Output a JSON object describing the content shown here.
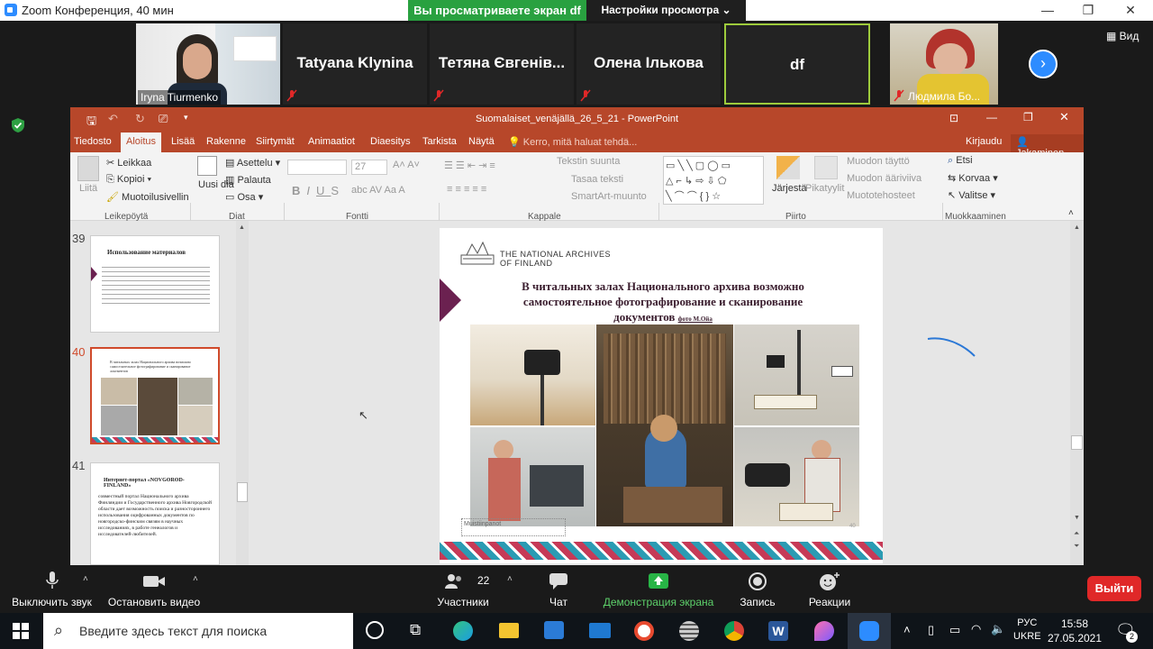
{
  "zoom": {
    "window_title": "Zoom Конференция, 40 мин",
    "share_banner": "Вы просматриваете экран df",
    "view_options": "Настройки просмотра ⌄",
    "view_label": "Вид",
    "participants": [
      {
        "name": "Iryna Tiurmenko",
        "has_video": true
      },
      {
        "name": "Tatyana Klynina",
        "has_video": false
      },
      {
        "name": "Тетяна Євгенів...",
        "has_video": false
      },
      {
        "name": "Олена Ількова",
        "has_video": false
      },
      {
        "name": "df",
        "has_video": false,
        "active": true
      },
      {
        "name": "Людмила Бо...",
        "has_video": true
      }
    ],
    "toolbar": {
      "mute": "Выключить звук",
      "stop_video": "Остановить видео",
      "participants_label": "Участники",
      "participants_count": "22",
      "chat": "Чат",
      "share": "Демонстрация экрана",
      "record": "Запись",
      "reactions": "Реакции",
      "leave": "Выйти"
    }
  },
  "ppt": {
    "title": "Suomalaiset_venäjällä_26_5_21 - PowerPoint",
    "tabs": [
      "Tiedosto",
      "Aloitus",
      "Lisää",
      "Rakenne",
      "Siirtymät",
      "Animaatiot",
      "Diaesitys",
      "Tarkista",
      "Näytä"
    ],
    "tell_me": "Kerro, mitä haluat tehdä...",
    "signin": "Kirjaudu",
    "share": "Jakaminen",
    "ribbon": {
      "paste": "Liitä",
      "cut": "Leikkaa",
      "copy": "Kopioi",
      "format_painter": "Muotoilusivellin",
      "clipboard": "Leikepöytä",
      "new_slide": "Uusi dia",
      "layout": "Asettelu",
      "reset": "Palauta",
      "section": "Osa",
      "slides": "Diat",
      "font_size": "27",
      "font": "Fontti",
      "text_direction": "Tekstin suunta",
      "align_text": "Tasaa teksti",
      "smartart": "SmartArt-muunto",
      "paragraph": "Kappale",
      "arrange": "Järjestä",
      "quick_styles": "Pikatyylit",
      "shape_fill": "Muodon täyttö",
      "shape_outline": "Muodon ääriviiva",
      "shape_effects": "Muototehosteet",
      "drawing": "Piirto",
      "find": "Etsi",
      "replace": "Korvaa",
      "select": "Valitse",
      "editing": "Muokkaaminen"
    },
    "thumbnails": [
      {
        "num": "39",
        "title": "Использование материалов"
      },
      {
        "num": "40",
        "title": "В читальных залах Национального архива возможно самостоятельное фотографирование и сканирование документов"
      },
      {
        "num": "41",
        "title": "Интернет-портал «NOVGOROD-FINLAND»",
        "body": "совместный портал Национального архива Финляндии и Государственного архива Новгородской области дает возможность поиска и разностороннего использования оцифрованных документов по новгородско-финским связям в научных исследованиях, в работе генеалогов и исследователей-любителей."
      }
    ],
    "slide": {
      "logo_line1": "THE NATIONAL ARCHIVES",
      "logo_line2": "OF FINLAND",
      "heading": "В читальных залах Национального архива возможно самостоятельное фотографирование и сканирование документов",
      "photo_credit": "фото М.Ойа",
      "notes_placeholder": "Muistiinpanot",
      "slide_number": "40"
    }
  },
  "taskbar": {
    "search_placeholder": "Введите здесь текст для поиска",
    "lang": "РУС",
    "lang2": "UKRE",
    "time": "15:58",
    "date": "27.05.2021",
    "notifications": "2"
  }
}
